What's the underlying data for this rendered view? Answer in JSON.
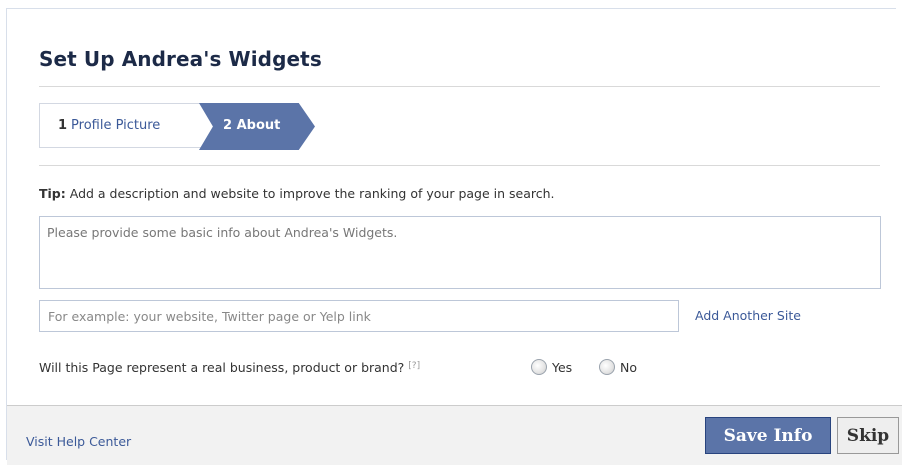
{
  "dialog": {
    "title": "Set Up Andrea's Widgets"
  },
  "steps": [
    {
      "number": "1",
      "label": "Profile Picture"
    },
    {
      "number": "2",
      "label": "About"
    }
  ],
  "tip": {
    "prefix": "Tip:",
    "text": " Add a description and website to improve the ranking of your page in search."
  },
  "about_field": {
    "placeholder": "Please provide some basic info about Andrea's Widgets."
  },
  "website_field": {
    "placeholder": "For example: your website, Twitter page or Yelp link"
  },
  "add_site_label": "Add Another Site",
  "question": {
    "text": "Will this Page represent a real business, product or brand?",
    "help": "[?]",
    "options": [
      "Yes",
      "No"
    ]
  },
  "footer": {
    "help_link": "Visit Help Center",
    "save_label": "Save Info",
    "skip_label": "Skip"
  },
  "colors": {
    "accent": "#5b74a8",
    "link": "#3b5998",
    "title": "#1c2a47"
  }
}
